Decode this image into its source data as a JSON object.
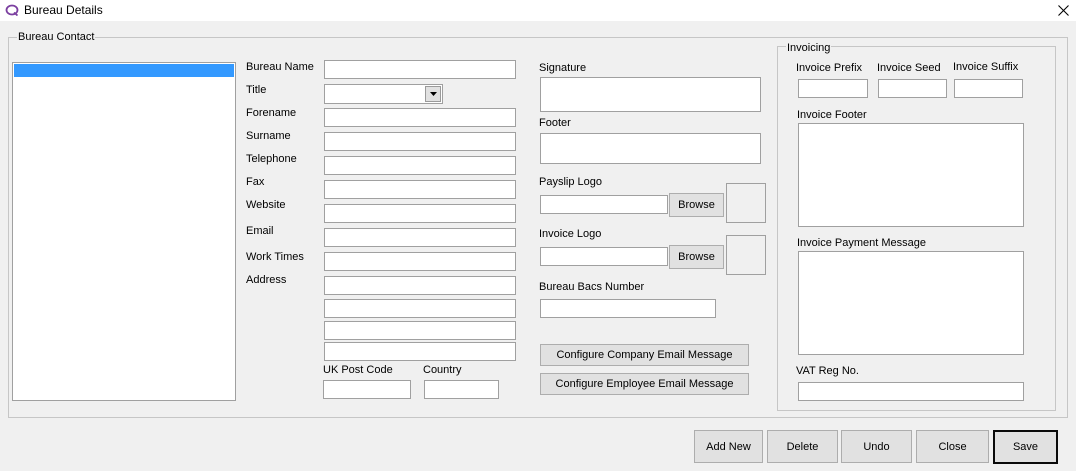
{
  "window": {
    "title": "Bureau Details",
    "close_glyph": "✕"
  },
  "bureau_contact": {
    "group_title": "Bureau Contact",
    "labels": {
      "bureau_name": "Bureau Name",
      "title": "Title",
      "forename": "Forename",
      "surname": "Surname",
      "telephone": "Telephone",
      "fax": "Fax",
      "website": "Website",
      "email": "Email",
      "work_times": "Work Times",
      "address": "Address",
      "uk_post_code": "UK Post Code",
      "country": "Country"
    },
    "values": {
      "bureau_name": "",
      "title": "",
      "forename": "",
      "surname": "",
      "telephone": "",
      "fax": "",
      "website": "",
      "email": "",
      "work_times": "",
      "address_line_1": "",
      "address_line_2": "",
      "address_line_3": "",
      "address_line_4": "",
      "uk_post_code": "",
      "country": ""
    },
    "list_items": [
      ""
    ]
  },
  "branding": {
    "signature_label": "Signature",
    "footer_label": "Footer",
    "payslip_logo_label": "Payslip Logo",
    "invoice_logo_label": "Invoice Logo",
    "bacs_label": "Bureau Bacs Number",
    "browse_label": "Browse",
    "configure_company_label": "Configure Company Email Message",
    "configure_employee_label": "Configure Employee Email Message",
    "signature_value": "",
    "footer_value": "",
    "payslip_logo_path": "",
    "invoice_logo_path": "",
    "bacs_value": ""
  },
  "invoicing": {
    "group_title": "Invoicing",
    "prefix_label": "Invoice Prefix",
    "seed_label": "Invoice Seed",
    "suffix_label": "Invoice Suffix",
    "footer_label": "Invoice Footer",
    "payment_message_label": "Invoice Payment Message",
    "vat_label": "VAT Reg No.",
    "prefix_value": "",
    "seed_value": "",
    "suffix_value": "",
    "footer_value": "",
    "payment_message_value": "",
    "vat_value": ""
  },
  "actions": {
    "add_new": "Add New",
    "delete": "Delete",
    "undo": "Undo",
    "close": "Close",
    "save": "Save"
  },
  "colors": {
    "selection": "#3399ff",
    "background": "#f0f0f0",
    "app_icon": "#7b3fa0"
  },
  "icons": {
    "app": "app-logo-icon",
    "close": "close-icon",
    "dropdown": "chevron-down-icon"
  }
}
